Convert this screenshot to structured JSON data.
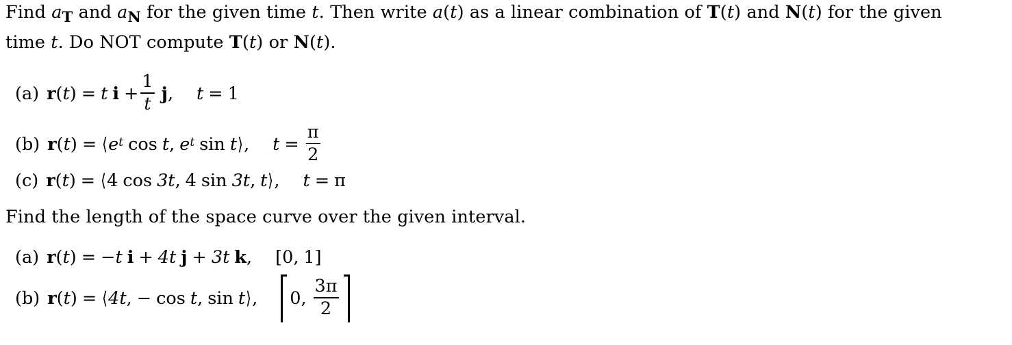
{
  "document": {
    "problem1": {
      "statement_line1_a": "Find ",
      "statement_a_var": "a",
      "statement_a_sub_T": "T",
      "statement_line1_b": " and ",
      "statement_a_var2": "a",
      "statement_a_sub_N": "N",
      "statement_line1_c": " for the given time ",
      "statement_t1": "t",
      "statement_line1_d": ". Then write ",
      "statement_at": "a",
      "statement_at_arg": "(",
      "statement_at_t": "t",
      "statement_at_close": ")",
      "statement_line1_e": " as a linear combination of ",
      "statement_T": "T",
      "statement_T_open": "(",
      "statement_T_t": "t",
      "statement_T_close": ")",
      "statement_line1_f": " and ",
      "statement_N": "N",
      "statement_N_open": "(",
      "statement_N_t": "t",
      "statement_N_close": ")",
      "statement_line1_g": " for the given",
      "statement_line2_a": "time ",
      "statement_line2_t": "t",
      "statement_line2_b": ". Do NOT compute ",
      "statement_line2_T": "T",
      "statement_line2_T_open": "(",
      "statement_line2_T_t": "t",
      "statement_line2_T_close": ")",
      "statement_line2_c": " or ",
      "statement_line2_N": "N",
      "statement_line2_N_open": "(",
      "statement_line2_N_t": "t",
      "statement_line2_N_close": ").",
      "items": [
        {
          "label": "(a)",
          "fn_name": "r",
          "fn_open": "(",
          "fn_arg": "t",
          "fn_close": ")",
          "equals": "=",
          "term1_coeff": "t",
          "term1_vec": "i",
          "plus": "+",
          "frac_num": "1",
          "frac_den": "t",
          "term2_vec": "j",
          "comma": ",",
          "cond_var": "t",
          "cond_eq": "=",
          "cond_val": "1"
        },
        {
          "label": "(b)",
          "fn_name": "r",
          "fn_open": "(",
          "fn_arg": "t",
          "fn_close": ")",
          "equals": "=",
          "bra": "⟨",
          "comp1_base": "e",
          "comp1_exp": "t",
          "comp1_op": "cos",
          "comp1_arg": "t",
          "comp_comma": ",",
          "comp2_base": "e",
          "comp2_exp": "t",
          "comp2_op": "sin",
          "comp2_arg": "t",
          "ket": "⟩",
          "comma": ",",
          "cond_var": "t",
          "cond_eq": "=",
          "cond_num": "π",
          "cond_den": "2"
        },
        {
          "label": "(c)",
          "fn_name": "r",
          "fn_open": "(",
          "fn_arg": "t",
          "fn_close": ")",
          "equals": "=",
          "bra": "⟨",
          "comp1_coeff": "4",
          "comp1_op": "cos",
          "comp1_arg": "3t",
          "comp_comma1": ",",
          "comp2_coeff": "4",
          "comp2_op": "sin",
          "comp2_arg": "3t",
          "comp_comma2": ",",
          "comp3": "t",
          "ket": "⟩",
          "comma": ",",
          "cond_var": "t",
          "cond_eq": "=",
          "cond_val": "π"
        }
      ]
    },
    "problem2": {
      "statement": "Find the length of the space curve over the given interval.",
      "items": [
        {
          "label": "(a)",
          "fn_name": "r",
          "fn_open": "(",
          "fn_arg": "t",
          "fn_close": ")",
          "equals": "=",
          "term1": "−t",
          "term1_vec": "i",
          "plus1": "+",
          "term2": "4t",
          "term2_vec": "j",
          "plus2": "+",
          "term3": "3t",
          "term3_vec": "k",
          "comma": ",",
          "interval_open": "[",
          "interval_lo": "0",
          "interval_comma": ",",
          "interval_hi": "1",
          "interval_close": "]"
        },
        {
          "label": "(b)",
          "fn_name": "r",
          "fn_open": "(",
          "fn_arg": "t",
          "fn_close": ")",
          "equals": "=",
          "bra": "⟨",
          "comp1": "4t",
          "comp_comma1": ",",
          "comp2_sign": "−",
          "comp2_op": "cos",
          "comp2_arg": "t",
          "comp_comma2": ",",
          "comp3_op": "sin",
          "comp3_arg": "t",
          "ket": "⟩",
          "comma": ",",
          "interval_lo": "0",
          "interval_comma": ",",
          "interval_num": "3π",
          "interval_den": "2"
        }
      ]
    }
  }
}
